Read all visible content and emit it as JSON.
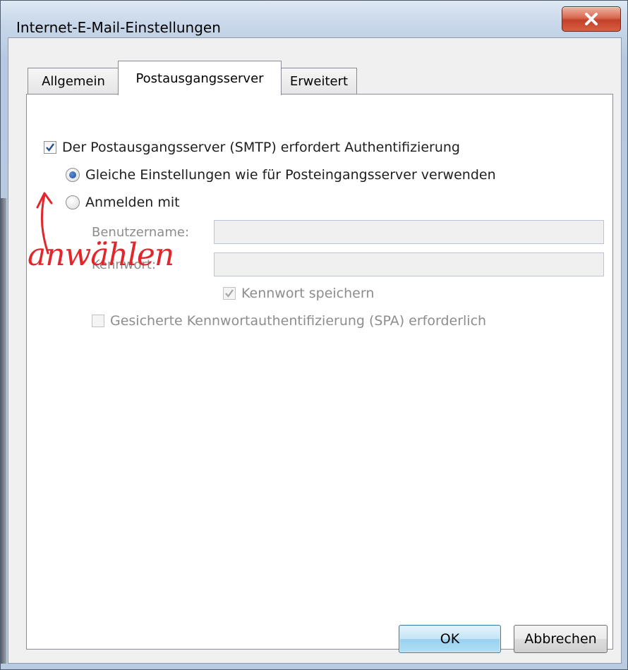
{
  "window": {
    "title": "Internet-E-Mail-Einstellungen"
  },
  "tabs": [
    {
      "label": "Allgemein",
      "active": false
    },
    {
      "label": "Postausgangsserver",
      "active": true
    },
    {
      "label": "Erweitert",
      "active": false
    }
  ],
  "options": {
    "smtp_auth_label": "Der Postausgangsserver (SMTP) erfordert Authentifizierung",
    "smtp_auth_checked": true,
    "same_settings_label": "Gleiche Einstellungen wie für Posteingangsserver verwenden",
    "same_settings_selected": true,
    "login_with_label": "Anmelden mit",
    "login_with_selected": false,
    "username_label": "Benutzername:",
    "username_value": "",
    "password_label": "Kennwort:",
    "password_value": "",
    "remember_password_label": "Kennwort speichern",
    "remember_password_checked": true,
    "spa_label": "Gesicherte Kennwortauthentifizierung (SPA) erforderlich",
    "spa_checked": false
  },
  "annotation": {
    "text": "anwählen",
    "color": "#e3262c"
  },
  "buttons": {
    "ok": "OK",
    "cancel": "Abbrechen"
  },
  "icons": {
    "close": "close-icon",
    "arrow": "arrow-up-icon"
  }
}
